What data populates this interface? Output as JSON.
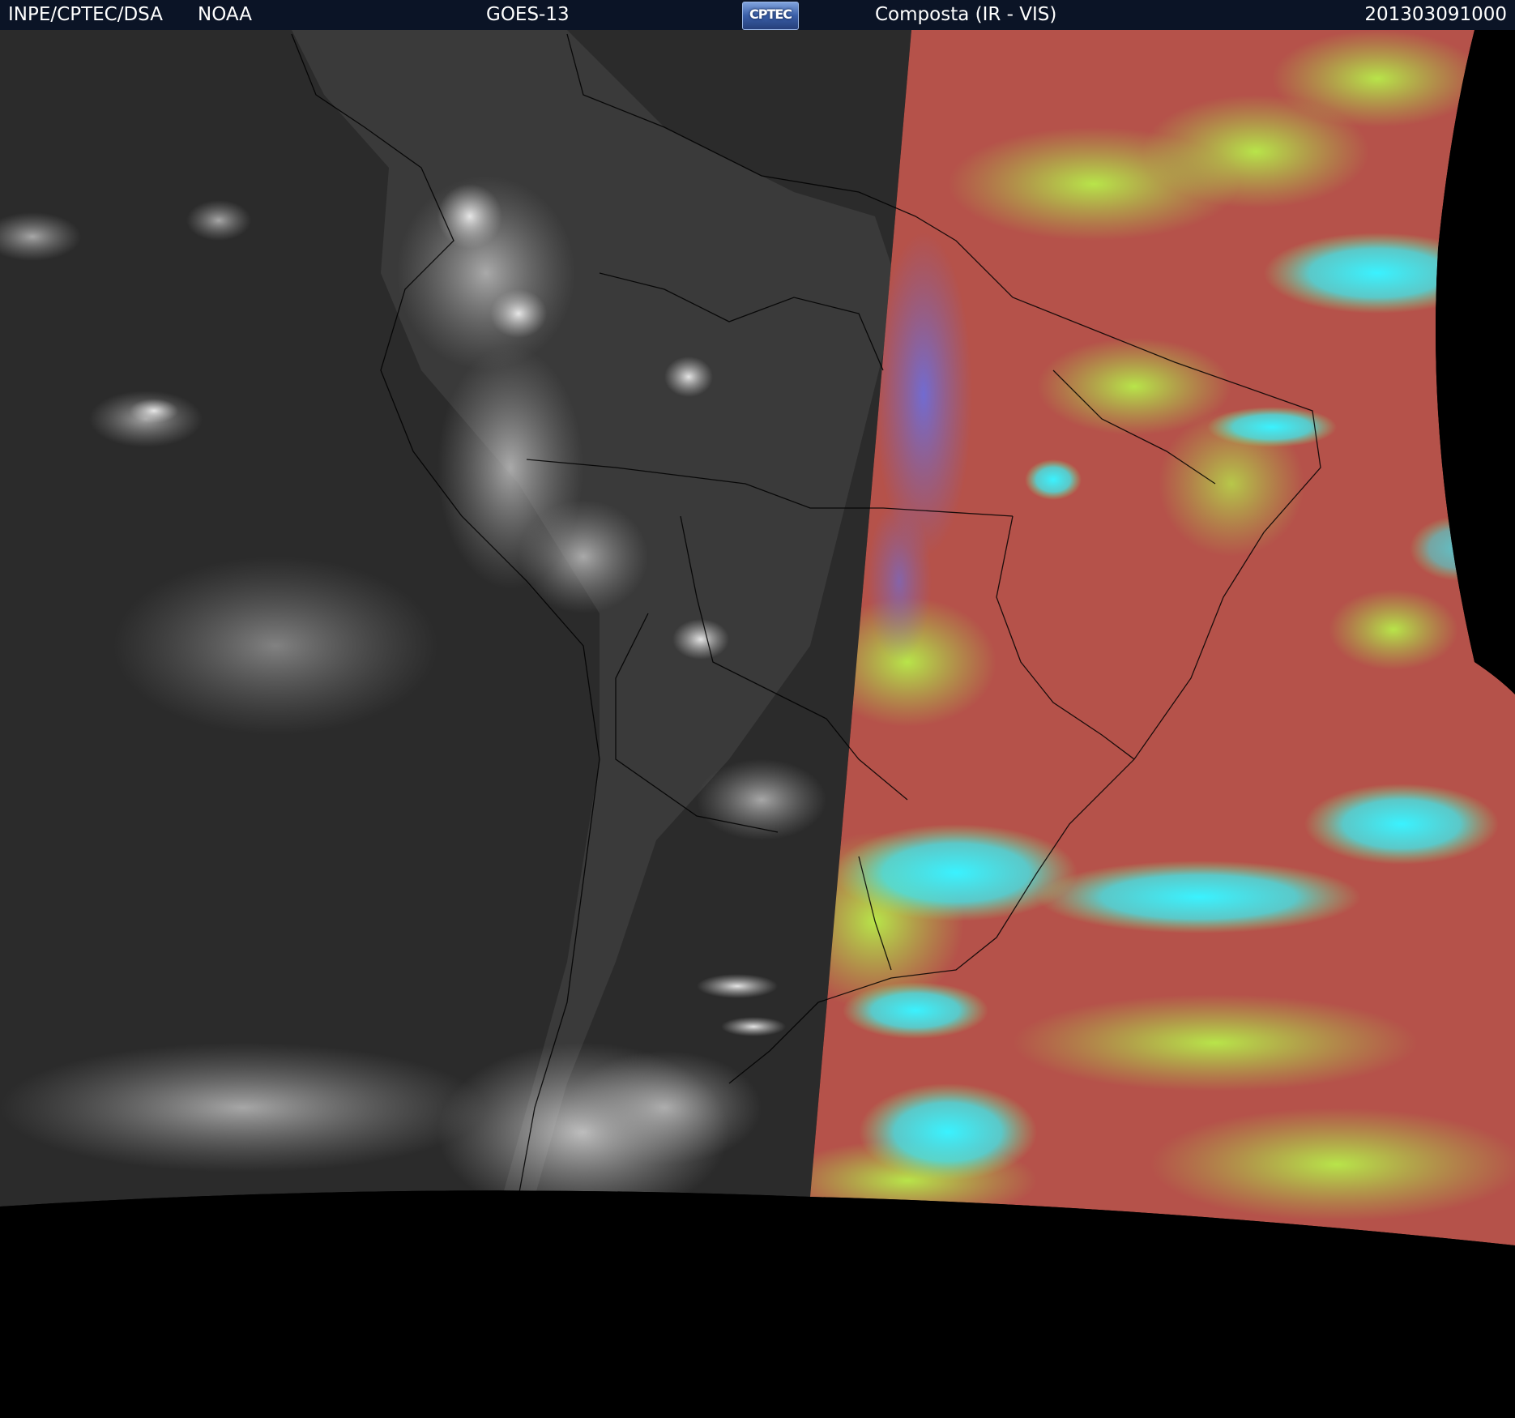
{
  "header": {
    "agency": "INPE/CPTEC/DSA",
    "source": "NOAA",
    "satellite": "GOES-13",
    "logo_text": "CPTEC",
    "product": "Composta (IR - VIS)",
    "datetime": "201303091000"
  },
  "colors": {
    "header_background": "#0b1426",
    "space_background": "#000000",
    "night_ocean": "#2a2a2a",
    "night_cloud": "#9a9a9a",
    "day_surface": "#b5524a",
    "day_cloud_low": "#a6e24a",
    "day_cloud_high": "#2ee8f0"
  },
  "image": {
    "description_icon": "satellite-composite-image"
  }
}
